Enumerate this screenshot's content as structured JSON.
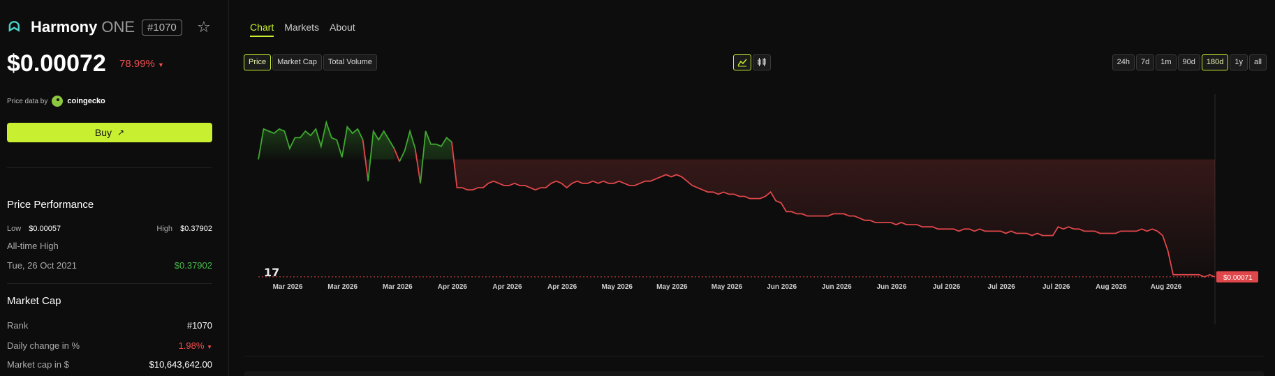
{
  "header": {
    "name": "Harmony",
    "ticker": "ONE",
    "rank_badge": "#1070",
    "price": "$0.00072",
    "change": "78.99%",
    "price_data_by": "Price data by",
    "provider": "coingecko",
    "buy_label": "Buy",
    "colors": {
      "accent": "#c8f031",
      "negative": "#ef4e4e",
      "positive": "#46b94a"
    }
  },
  "performance": {
    "title": "Price Performance",
    "low_label": "Low",
    "low_value": "$0.00057",
    "high_label": "High",
    "high_value": "$0.37902",
    "ath_label": "All-time High",
    "ath_date": "Tue, 26 Oct 2021",
    "ath_value": "$0.37902"
  },
  "market_cap": {
    "title": "Market Cap",
    "rank_label": "Rank",
    "rank_value": "#1070",
    "daily_label": "Daily change in %",
    "daily_value": "1.98%",
    "mcap_label": "Market cap in $",
    "mcap_value": "$10,643,642.00"
  },
  "tabs": [
    {
      "label": "Chart",
      "active": true
    },
    {
      "label": "Markets",
      "active": false
    },
    {
      "label": "About",
      "active": false
    }
  ],
  "metric_buttons": [
    {
      "label": "Price",
      "active": true
    },
    {
      "label": "Market Cap",
      "active": false
    },
    {
      "label": "Total Volume",
      "active": false
    }
  ],
  "chart_type_icons": [
    "line-chart-icon",
    "candlestick-icon"
  ],
  "range_buttons": [
    {
      "label": "24h",
      "active": false
    },
    {
      "label": "7d",
      "active": false
    },
    {
      "label": "1m",
      "active": false
    },
    {
      "label": "90d",
      "active": false
    },
    {
      "label": "180d",
      "active": true
    },
    {
      "label": "1y",
      "active": false
    },
    {
      "label": "all",
      "active": false
    }
  ],
  "chart_data": {
    "type": "line",
    "title": "",
    "xlabel": "",
    "ylabel": "",
    "x_tick_labels": [
      "Mar 2026",
      "Mar 2026",
      "Mar 2026",
      "Apr 2026",
      "Apr 2026",
      "Apr 2026",
      "May 2026",
      "May 2026",
      "May 2026",
      "Jun 2026",
      "Jun 2026",
      "Jun 2026",
      "Jul 2026",
      "Jul 2026",
      "Jul 2026",
      "Aug 2026",
      "Aug 2026"
    ],
    "current_price_label": "$0.00071",
    "baseline": 0.00125,
    "ylim": [
      0.0007,
      0.00155
    ],
    "colors": {
      "up": "#3fa830",
      "down": "#e0474a"
    },
    "values": [
      0.00125,
      0.00139,
      0.00138,
      0.00137,
      0.00139,
      0.00138,
      0.0013,
      0.00135,
      0.00135,
      0.00138,
      0.00136,
      0.00139,
      0.00131,
      0.00142,
      0.00135,
      0.00134,
      0.00126,
      0.0014,
      0.00137,
      0.00139,
      0.00134,
      0.00115,
      0.00138,
      0.00134,
      0.00138,
      0.00134,
      0.0013,
      0.00124,
      0.00129,
      0.00138,
      0.0013,
      0.00114,
      0.00138,
      0.00132,
      0.00132,
      0.00131,
      0.00135,
      0.00133,
      0.00112,
      0.00112,
      0.00111,
      0.00111,
      0.00112,
      0.00112,
      0.00114,
      0.00115,
      0.00114,
      0.00113,
      0.00113,
      0.00114,
      0.00113,
      0.00113,
      0.00112,
      0.00111,
      0.00112,
      0.00112,
      0.00114,
      0.00115,
      0.00114,
      0.00112,
      0.00114,
      0.00115,
      0.00114,
      0.00114,
      0.00115,
      0.00114,
      0.00115,
      0.00114,
      0.00114,
      0.00115,
      0.00114,
      0.00113,
      0.00113,
      0.00114,
      0.00115,
      0.00115,
      0.00116,
      0.00117,
      0.00118,
      0.00117,
      0.00118,
      0.00117,
      0.00115,
      0.00113,
      0.00112,
      0.00111,
      0.0011,
      0.0011,
      0.00109,
      0.0011,
      0.00109,
      0.00109,
      0.00108,
      0.00108,
      0.00107,
      0.00107,
      0.00107,
      0.00108,
      0.0011,
      0.00106,
      0.00105,
      0.00101,
      0.00101,
      0.001,
      0.001,
      0.00099,
      0.00099,
      0.00099,
      0.00099,
      0.00099,
      0.001,
      0.001,
      0.001,
      0.00099,
      0.00099,
      0.00098,
      0.00097,
      0.00097,
      0.00096,
      0.00096,
      0.00096,
      0.00096,
      0.00095,
      0.00096,
      0.00095,
      0.00095,
      0.00095,
      0.00094,
      0.00094,
      0.00094,
      0.00093,
      0.00093,
      0.00093,
      0.00093,
      0.00092,
      0.00093,
      0.00093,
      0.00092,
      0.00093,
      0.00092,
      0.00092,
      0.00092,
      0.00092,
      0.00091,
      0.00092,
      0.00091,
      0.00091,
      0.00091,
      0.0009,
      0.00091,
      0.0009,
      0.0009,
      0.0009,
      0.00094,
      0.00093,
      0.00094,
      0.00093,
      0.00093,
      0.00092,
      0.00092,
      0.00092,
      0.00091,
      0.00091,
      0.00091,
      0.00091,
      0.00092,
      0.00092,
      0.00092,
      0.00092,
      0.00093,
      0.00092,
      0.00093,
      0.00092,
      0.0009,
      0.00083,
      0.00072,
      0.00072,
      0.00072,
      0.00072,
      0.00072,
      0.00072,
      0.00071,
      0.00072,
      0.00071
    ]
  }
}
